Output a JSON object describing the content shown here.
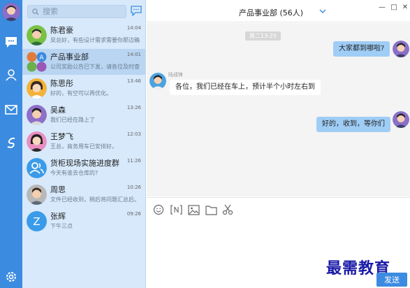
{
  "search": {
    "placeholder": "搜索"
  },
  "contacts": [
    {
      "name": "陈君豪",
      "time": "14:04",
      "preview": "吴总好，有些设计需求需要你那边确",
      "avatar": "man-green"
    },
    {
      "name": "产品事业部",
      "time": "14:01",
      "preview": "公司奖励公告已下发，请各位及时查",
      "avatar": "group"
    },
    {
      "name": "陈思彤",
      "time": "13:46",
      "preview": "好的，有空可以再优化。",
      "avatar": "woman-orange"
    },
    {
      "name": "吴森",
      "time": "13:26",
      "preview": "我们已经在路上了",
      "avatar": "man-purple"
    },
    {
      "name": "王梦飞",
      "time": "12:03",
      "preview": "王总，商务用车已安排好。",
      "avatar": "woman-pink"
    },
    {
      "name": "货柜现场实施进度群",
      "time": "11:26",
      "preview": "今天有谁去仓库的?",
      "avatar": "group-blue"
    },
    {
      "name": "周思",
      "time": "10:26",
      "preview": "文件已经收到，稍后将问题汇总后。",
      "avatar": "man-grey"
    },
    {
      "name": "张辉",
      "time": "09:26",
      "preview": "下午三点",
      "avatar": "letter-z",
      "letter": "Z"
    }
  ],
  "chat": {
    "title": "产品事业部 (56人)",
    "time_divider": "周二13:25",
    "messages": [
      {
        "dir": "out",
        "text": "大家都到哪啦?"
      },
      {
        "dir": "in",
        "sender": "陆成锋",
        "text": "各位，我们已经在车上，预计半个小时左右到"
      },
      {
        "dir": "out",
        "text": "好的，收到，等你们"
      }
    ]
  },
  "window": {
    "minimize": "—",
    "maximize": "□",
    "close": "✕"
  },
  "composer": {
    "value": ""
  },
  "send_label": "发送",
  "watermark": "最需教育",
  "colors": {
    "rail": "#3b8be0",
    "list_bg": "#d7e9fb",
    "active_row": "#b9d5f2",
    "out_bubble": "#9fcdf6",
    "send": "#3b8be0"
  }
}
